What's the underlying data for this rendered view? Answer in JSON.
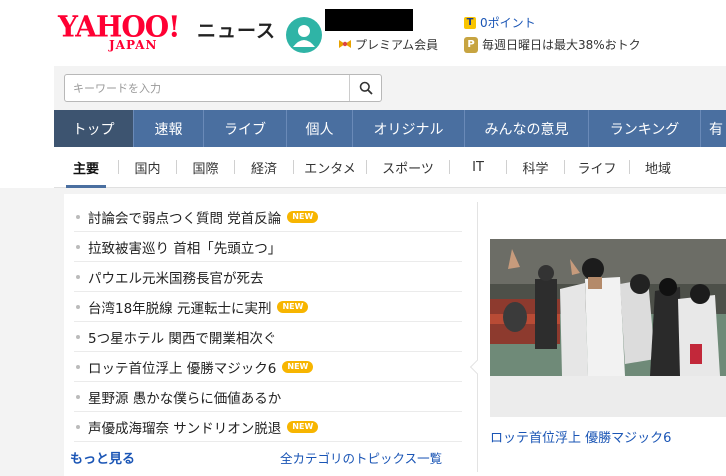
{
  "header": {
    "logo_main": "YAHOO!",
    "logo_sub": "JAPAN",
    "service_name": "ニュース",
    "premium_label": "プレミアム会員",
    "points_label": "0ポイント",
    "points_badge": "T",
    "promo_badge": "P",
    "promo_label": "毎週日曜日は最大38%おトク"
  },
  "search": {
    "placeholder": "キーワードを入力",
    "value": ""
  },
  "gnav": [
    {
      "label": "トップ",
      "active": true
    },
    {
      "label": "速報"
    },
    {
      "label": "ライブ"
    },
    {
      "label": "個人"
    },
    {
      "label": "オリジナル"
    },
    {
      "label": "みんなの意見"
    },
    {
      "label": "ランキング"
    },
    {
      "label": "有"
    }
  ],
  "subnav": [
    {
      "label": "主要",
      "active": true
    },
    {
      "label": "国内"
    },
    {
      "label": "国際"
    },
    {
      "label": "経済"
    },
    {
      "label": "エンタメ"
    },
    {
      "label": "スポーツ"
    },
    {
      "label": "IT"
    },
    {
      "label": "科学"
    },
    {
      "label": "ライフ"
    },
    {
      "label": "地域"
    }
  ],
  "topics": [
    {
      "title": "討論会で弱点つく質問 党首反論",
      "new": "NEW"
    },
    {
      "title": "拉致被害巡り 首相「先頭立つ」"
    },
    {
      "title": "パウエル元米国務長官が死去"
    },
    {
      "title": "台湾18年脱線 元運転士に実刑",
      "new": "NEW"
    },
    {
      "title": "5つ星ホテル 関西で開業相次ぐ"
    },
    {
      "title": "ロッテ首位浮上 優勝マジック6",
      "new": "NEW"
    },
    {
      "title": "星野源 愚かな僕らに価値あるか"
    },
    {
      "title": "声優成海瑠奈 サンドリオン脱退",
      "new": "NEW"
    }
  ],
  "more_label": "もっと見る",
  "all_topics_label": "全カテゴリのトピックス一覧",
  "feature_caption": "ロッテ首位浮上 優勝マジック6",
  "colors": {
    "brand_red": "#ff0033",
    "nav_blue": "#4a6fa0",
    "nav_active": "#3d5470",
    "link_blue": "#1a55b5",
    "new_badge": "#f7b500"
  }
}
